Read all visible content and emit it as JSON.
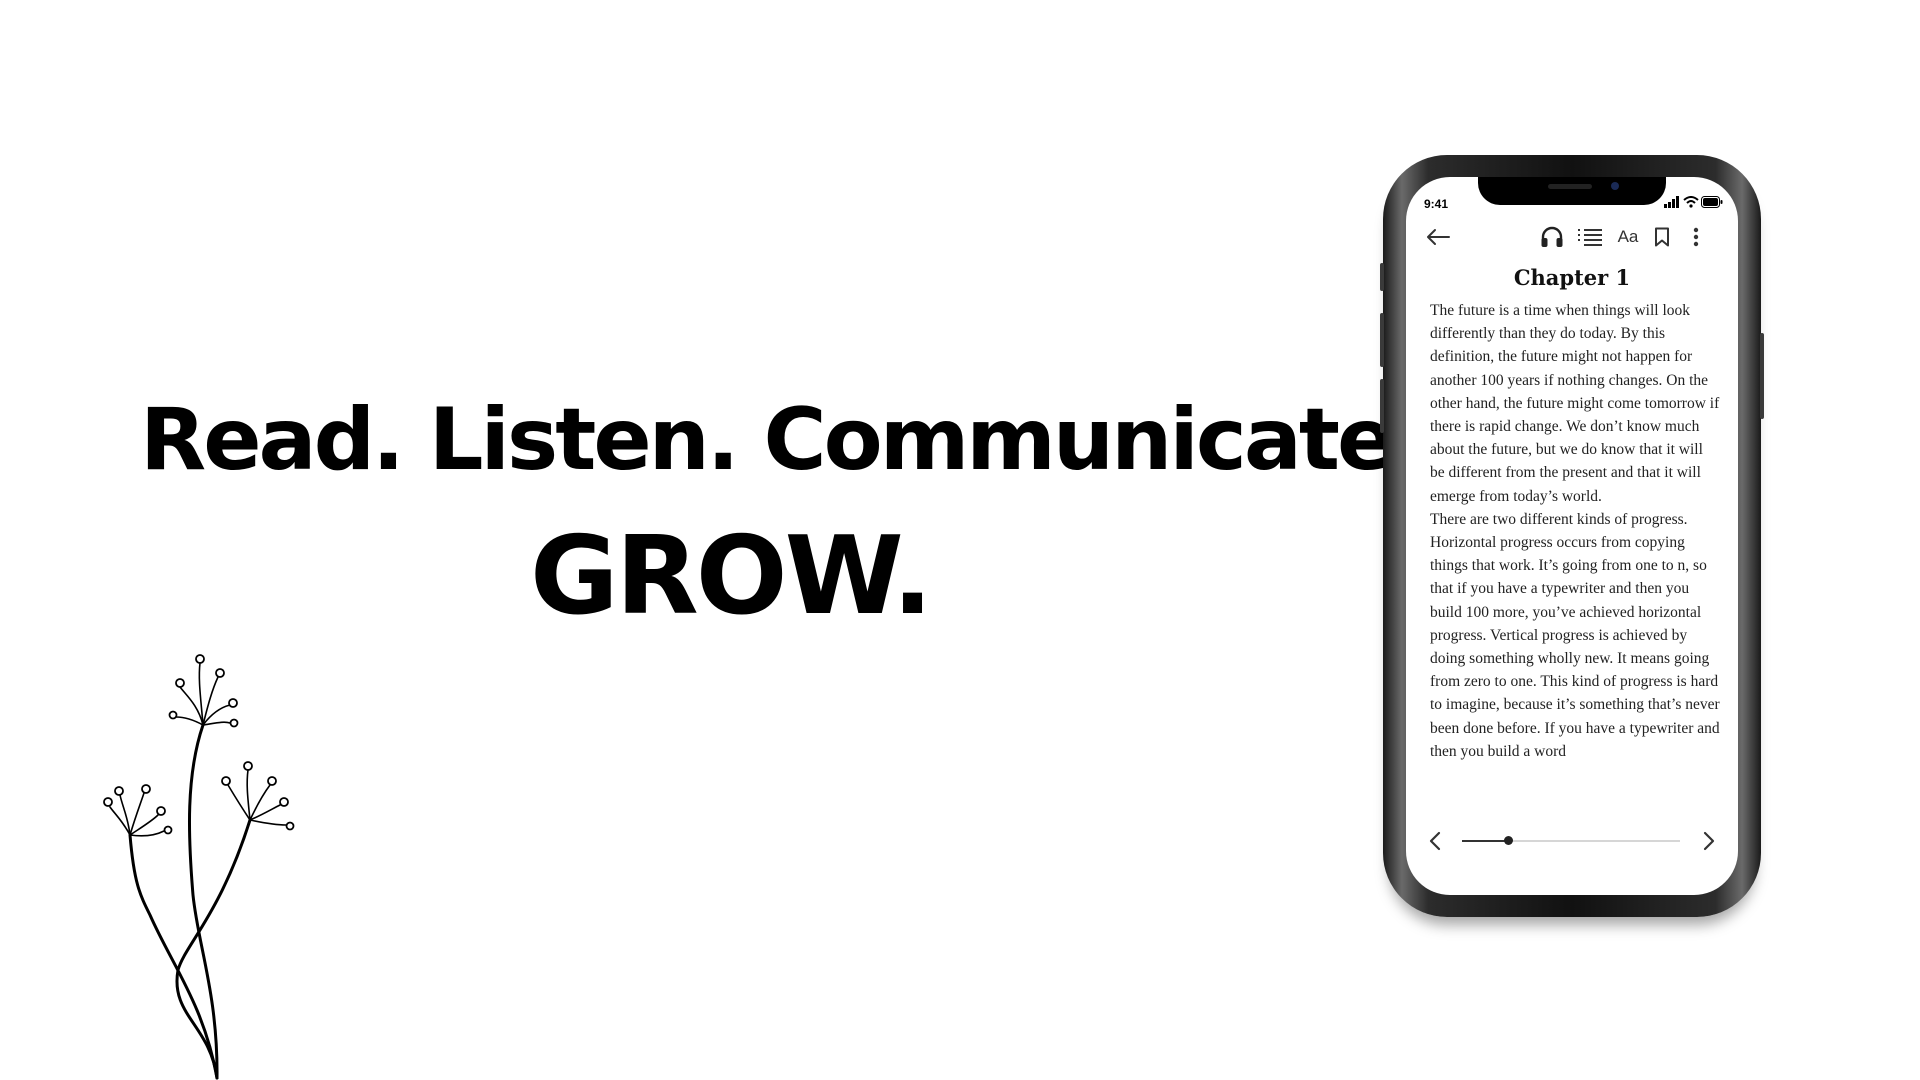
{
  "headline": {
    "tagline": "Read. Listen. Communicate.",
    "emphasis": "GROW."
  },
  "decoration": {
    "icon": "flower-illustration"
  },
  "phone": {
    "status": {
      "time": "9:41",
      "icons": [
        "signal-icon",
        "wifi-icon",
        "battery-icon"
      ]
    },
    "toolbar": {
      "back_icon": "arrow-left-icon",
      "audio_icon": "headphones-icon",
      "contents_icon": "list-icon",
      "font_label": "Aa",
      "bookmark_icon": "bookmark-icon",
      "more_icon": "more-vertical-icon"
    },
    "reader": {
      "chapter_title": "Chapter 1",
      "paragraphs": [
        "The future is a time when things will look differently than they do today. By this definition, the future might not happen for another 100 years if nothing changes. On the other hand, the future might come tomorrow if there is rapid change. We don’t know much about the future, but we do know that it will be different from the present and that it will emerge from today’s world.",
        "There are two different kinds of progress. Horizontal progress occurs from copying things that work. It’s going from one to n, so that if you have a typewriter and then you build 100 more, you’ve achieved horizontal progress. Vertical progress is achieved by doing something wholly new. It means going from zero to one. This kind of progress is hard to imagine, because it’s something that’s never been done before. If you have a typewriter and then you build a word"
      ]
    },
    "navigation": {
      "prev_icon": "chevron-left-icon",
      "next_icon": "chevron-right-icon",
      "progress": 0.21
    }
  }
}
